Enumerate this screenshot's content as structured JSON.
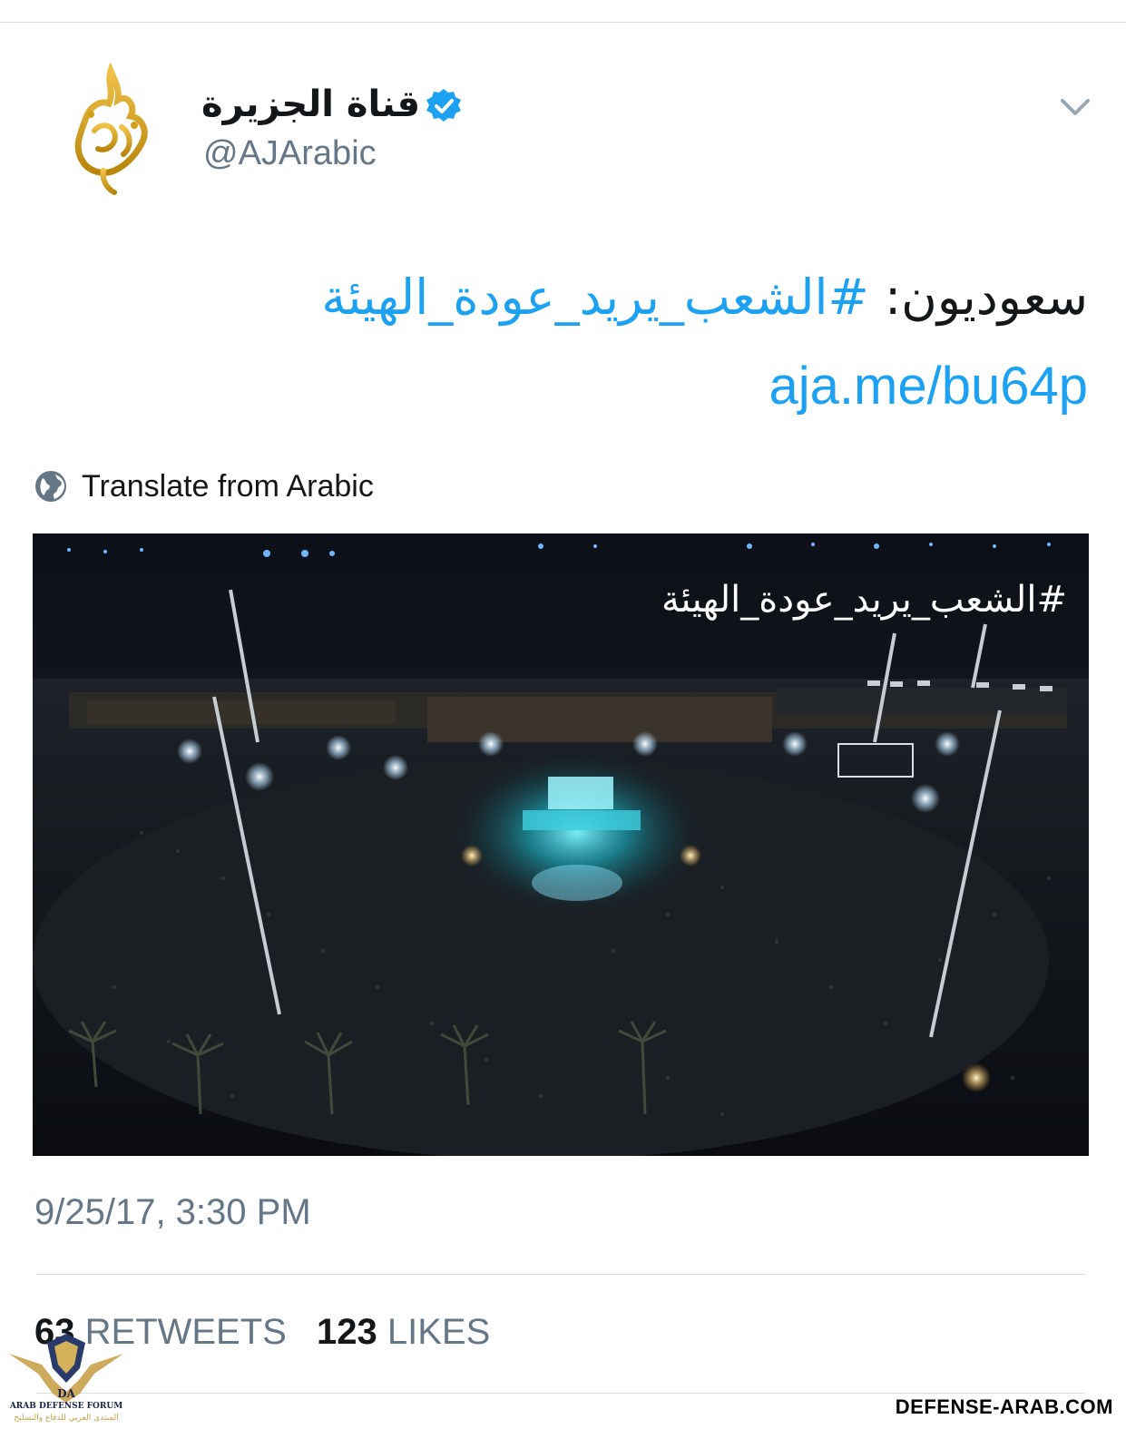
{
  "tweet": {
    "display_name": "قناة الجزيرة",
    "handle": "@AJArabic",
    "text_prefix": "سعوديون: ",
    "hashtag": "#الشعب_يريد_عودة_الهيئة",
    "link": "aja.me/bu64p",
    "translate_label": "Translate from Arabic",
    "media_caption": "#الشعب_يريد_عودة_الهيئة",
    "timestamp": "9/25/17, 3:30 PM",
    "retweets_count": "63",
    "retweets_label": "RETWEETS",
    "likes_count": "123",
    "likes_label": "LIKES"
  },
  "watermark": {
    "site": "DEFENSE-ARAB.COM",
    "forum_en": "ARAB DEFENSE FORUM",
    "forum_ar": "المنتدى العربي للدفاع والتسليح",
    "initials": "DA"
  },
  "colors": {
    "link_blue": "#1da1f2",
    "secondary_gray": "#657786",
    "brand_gold": "#d4a017"
  },
  "icons": [
    "aljazeera-logo-icon",
    "verified-badge-icon",
    "chevron-down-icon",
    "globe-icon"
  ]
}
